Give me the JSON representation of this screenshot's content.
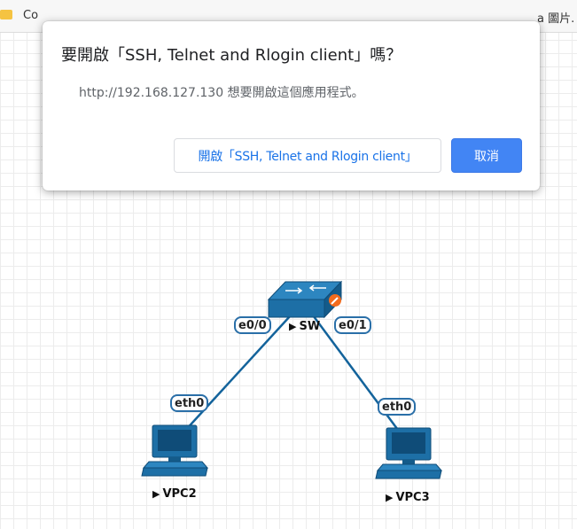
{
  "bookmarks": {
    "left_label": "Co",
    "right_label": "a 圖片."
  },
  "dialog": {
    "title": "要開啟「SSH, Telnet and Rlogin client」嗎？",
    "message": "http://192.168.127.130 想要開啟這個應用程式。",
    "open_label": "開啟「SSH, Telnet and Rlogin client」",
    "cancel_label": "取消"
  },
  "topology": {
    "switch": {
      "name": "SW",
      "icon": "switch-icon",
      "status_icon": "wrench-icon"
    },
    "links": [
      {
        "from_iface": "e0/0",
        "to_iface": "eth0",
        "to_node": "VPC2"
      },
      {
        "from_iface": "e0/1",
        "to_iface": "eth0",
        "to_node": "VPC3"
      }
    ],
    "hosts": [
      {
        "name": "VPC2",
        "icon": "computer-icon"
      },
      {
        "name": "VPC3",
        "icon": "computer-icon"
      }
    ],
    "colors": {
      "link": "#13639b",
      "device": "#1d6fa6",
      "device_dark": "#0f4c78",
      "label_border": "#2a6fa8"
    }
  }
}
